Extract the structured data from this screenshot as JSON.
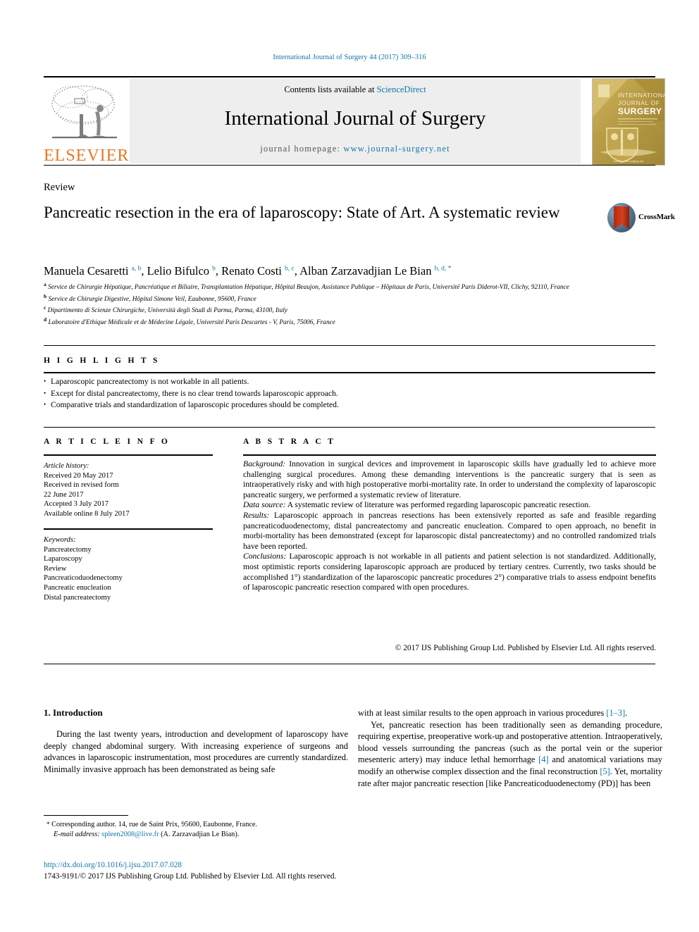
{
  "running_head": "International Journal of Surgery 44 (2017) 309–316",
  "header": {
    "contents_prefix": "Contents lists available at ",
    "contents_link": "ScienceDirect",
    "journal_title": "International Journal of Surgery",
    "homepage_prefix": "journal homepage: ",
    "homepage_url": "www.journal-surgery.net",
    "publisher_logo_text": "ELSEVIER",
    "cover_line1": "INTERNATIONAL",
    "cover_line2": "JOURNAL OF",
    "cover_line3": "SURGERY"
  },
  "article": {
    "type": "Review",
    "title": "Pancreatic resection in the era of laparoscopy: State of Art. A systematic review",
    "crossmark_label": "CrossMark",
    "authors_html": "Manuela Cesaretti <sup>a, b</sup>, Lelio Bifulco <sup>b</sup>, Renato Costi <sup>b, c</sup>, Alban Zarzavadjian Le Bian <sup>b, d, *</sup>",
    "affiliations": [
      "Service de Chirurgie Hépatique, Pancréatique et Biliaire, Transplantation Hépatique, Hôpital Beaujon, Assistance Publique – Hôpitaux de Paris, Université Paris Diderot-VII, Clichy, 92110, France",
      "Service de Chirurgie Digestive, Hôpital Simone Veil, Eaubonne, 95600, France",
      "Dipartimento di Scienze Chirurgiche, Università degli Studi di Parma, Parma, 43100, Italy",
      "Laboratoire d'Ethique Médicale et de Médecine Légale, Université Paris Descartes - V, Paris, 75006, France"
    ],
    "affiliation_markers": [
      "a",
      "b",
      "c",
      "d"
    ]
  },
  "highlights": {
    "label": "H I G H L I G H T S",
    "items": [
      "Laparoscopic pancreatectomy is not workable in all patients.",
      "Except for distal pancreatectomy, there is no clear trend towards laparoscopic approach.",
      "Comparative trials and standardization of laparoscopic procedures should be completed."
    ]
  },
  "article_info": {
    "label": "A R T I C L E   I N F O",
    "history_heading": "Article history:",
    "history_lines": [
      "Received 20 May 2017",
      "Received in revised form",
      "22 June 2017",
      "Accepted 3 July 2017",
      "Available online 8 July 2017"
    ],
    "keywords_heading": "Keywords:",
    "keywords": [
      "Pancreatectomy",
      "Laparoscopy",
      "Review",
      "Pancreaticoduodenectomy",
      "Pancreatic enucleation",
      "Distal pancreatectomy"
    ]
  },
  "abstract": {
    "label": "A B S T R A C T",
    "sections": [
      {
        "heading": "Background:",
        "text": " Innovation in surgical devices and improvement in laparoscopic skills have gradually led to achieve more challenging surgical procedures. Among these demanding interventions is the pancreatic surgery that is seen as intraoperatively risky and with high postoperative morbi-mortality rate. In order to understand the complexity of laparoscopic pancreatic surgery, we performed a systematic review of literature."
      },
      {
        "heading": "Data source:",
        "text": " A systematic review of literature was performed regarding laparoscopic pancreatic resection."
      },
      {
        "heading": "Results:",
        "text": " Laparoscopic approach in pancreas resections has been extensively reported as safe and feasible regarding pancreaticoduodenectomy, distal pancreatectomy and pancreatic enucleation. Compared to open approach, no benefit in morbi-mortality has been demonstrated (except for laparoscopic distal pancreatectomy) and no controlled randomized trials have been reported."
      },
      {
        "heading": "Conclusions:",
        "text": " Laparoscopic approach is not workable in all patients and patient selection is not standardized. Additionally, most optimistic reports considering laparoscopic approach are produced by tertiary centres. Currently, two tasks should be accomplished 1°) standardization of the laparoscopic pancreatic procedures 2°) comparative trials to assess endpoint benefits of laparoscopic pancreatic resection compared with open procedures."
      }
    ],
    "copyright": "© 2017 IJS Publishing Group Ltd. Published by Elsevier Ltd. All rights reserved."
  },
  "body": {
    "section_number_title": "1. Introduction",
    "left_paragraph": "During the last twenty years, introduction and development of laparoscopy have deeply changed abdominal surgery. With increasing experience of surgeons and advances in laparoscopic instrumentation, most procedures are currently standardized. Minimally invasive approach has been demonstrated as being safe",
    "right_paragraph_1_html": "with at least similar results to the open approach in various procedures <span class=\"ref\">[1–3]</span>.",
    "right_paragraph_2_html": "Yet, pancreatic resection has been traditionally seen as demanding procedure, requiring expertise, preoperative work-up and postoperative attention. Intraoperatively, blood vessels surrounding the pancreas (such as the portal vein or the superior mesenteric artery) may induce lethal hemorrhage <span class=\"ref\">[4]</span> and anatomical variations may modify an otherwise complex dissection and the final reconstruction <span class=\"ref\">[5]</span>. Yet, mortality rate after major pancreatic resection [like Pancreaticoduodenectomy (PD)] has been"
  },
  "footer": {
    "corresponding_marker": "*",
    "corresponding_text": "Corresponding author. 14, rue de Saint Prix, 95600, Eaubonne, France.",
    "email_label": "E-mail address:",
    "email_address": "spleen2008@live.fr",
    "email_owner": "(A. Zarzavadjian Le Bian).",
    "doi": "http://dx.doi.org/10.1016/j.ijsu.2017.07.028",
    "issn_line": "1743-9191/© 2017 IJS Publishing Group Ltd. Published by Elsevier Ltd. All rights reserved."
  },
  "colors": {
    "link_blue": "#1076a8",
    "elsevier_orange": "#e87722",
    "band_gray": "#eeeeee"
  }
}
